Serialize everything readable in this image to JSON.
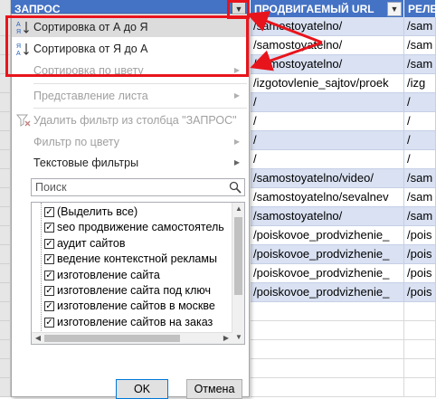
{
  "columns": {
    "col1": "ЗАПРОС",
    "col2": "ПРОДВИГАЕМЫЙ URL",
    "col3": "РЕЛЕ"
  },
  "rows": [
    {
      "url": "/samostoyatelno/",
      "rel": "/sam"
    },
    {
      "url": "/samostoyatelno/",
      "rel": "/sam"
    },
    {
      "url": "/samostoyatelno/",
      "rel": "/sam"
    },
    {
      "url": "/izgotovlenie_sajtov/proek",
      "rel": "/izg"
    },
    {
      "url": "/",
      "rel": "/"
    },
    {
      "url": "/",
      "rel": "/"
    },
    {
      "url": "/",
      "rel": "/"
    },
    {
      "url": "/",
      "rel": "/"
    },
    {
      "url": "/samostoyatelno/video/",
      "rel": "/sam"
    },
    {
      "url": "/samostoyatelno/sevalnev",
      "rel": "/sam"
    },
    {
      "url": "/samostoyatelno/",
      "rel": "/sam"
    },
    {
      "url": "/poiskovoe_prodvizhenie_",
      "rel": "/pois"
    },
    {
      "url": "/poiskovoe_prodvizhenie_",
      "rel": "/pois"
    },
    {
      "url": "/poiskovoe_prodvizhenie_",
      "rel": "/pois"
    },
    {
      "url": "/poiskovoe_prodvizhenie_",
      "rel": "/pois"
    }
  ],
  "menu": {
    "sort_asc": "Сортировка от А до Я",
    "sort_desc": "Сортировка от Я до А",
    "sort_color": "Сортировка по цвету",
    "sheet_view": "Представление листа",
    "clear_filter": "Удалить фильтр из столбца \"ЗАПРОС\"",
    "filter_color": "Фильтр по цвету",
    "text_filters": "Текстовые фильтры"
  },
  "search": {
    "placeholder": "Поиск"
  },
  "list_items": [
    "(Выделить все)",
    "seo продвижение самостоятель",
    "аудит сайтов",
    "ведение контекстной рекламы",
    "изготовление сайта",
    "изготовление сайта под ключ",
    "изготовление сайтов в москве",
    "изготовление сайтов на заказ"
  ],
  "buttons": {
    "ok": "OK",
    "cancel": "Отмена"
  },
  "colors": {
    "header_blue": "#4472c4",
    "band_blue": "#d9e1f2",
    "highlight_red": "#e8141c"
  }
}
